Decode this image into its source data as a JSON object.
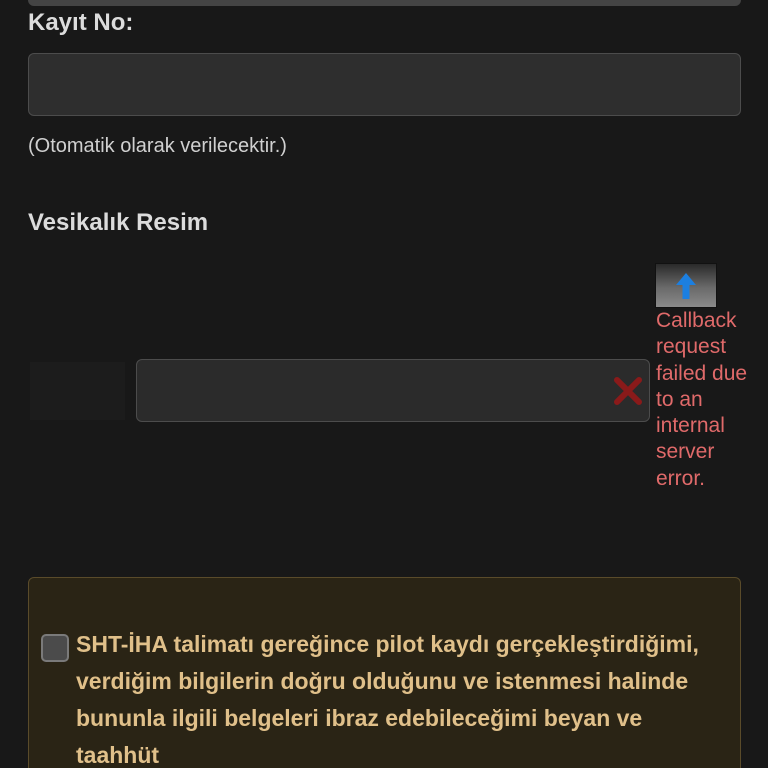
{
  "form": {
    "registration_label": "Kayıt No:",
    "registration_value": "",
    "registration_hint": "(Otomatik olarak verilecektir.)",
    "photo_label": "Vesikalık Resim",
    "file_value": "",
    "error_message": "Callback request failed due to an internal server error."
  },
  "consent": {
    "checked": false,
    "text": "SHT-İHA talimatı gereğince pilot kaydı gerçekleştirdiğimi, verdiğim bilgilerin doğru olduğunu ve istenmesi halinde bununla ilgili belgeleri ibraz edebileceğimi beyan ve taahhüt"
  },
  "colors": {
    "background": "#181818",
    "error": "#e06a6a",
    "consent_text": "#e0c08a",
    "consent_panel": "#2a2415",
    "upload_arrow": "#1c7fe0",
    "remove_x": "#8a1a1a"
  },
  "icons": {
    "upload": "upload-arrow-icon",
    "remove": "remove-x-icon"
  }
}
